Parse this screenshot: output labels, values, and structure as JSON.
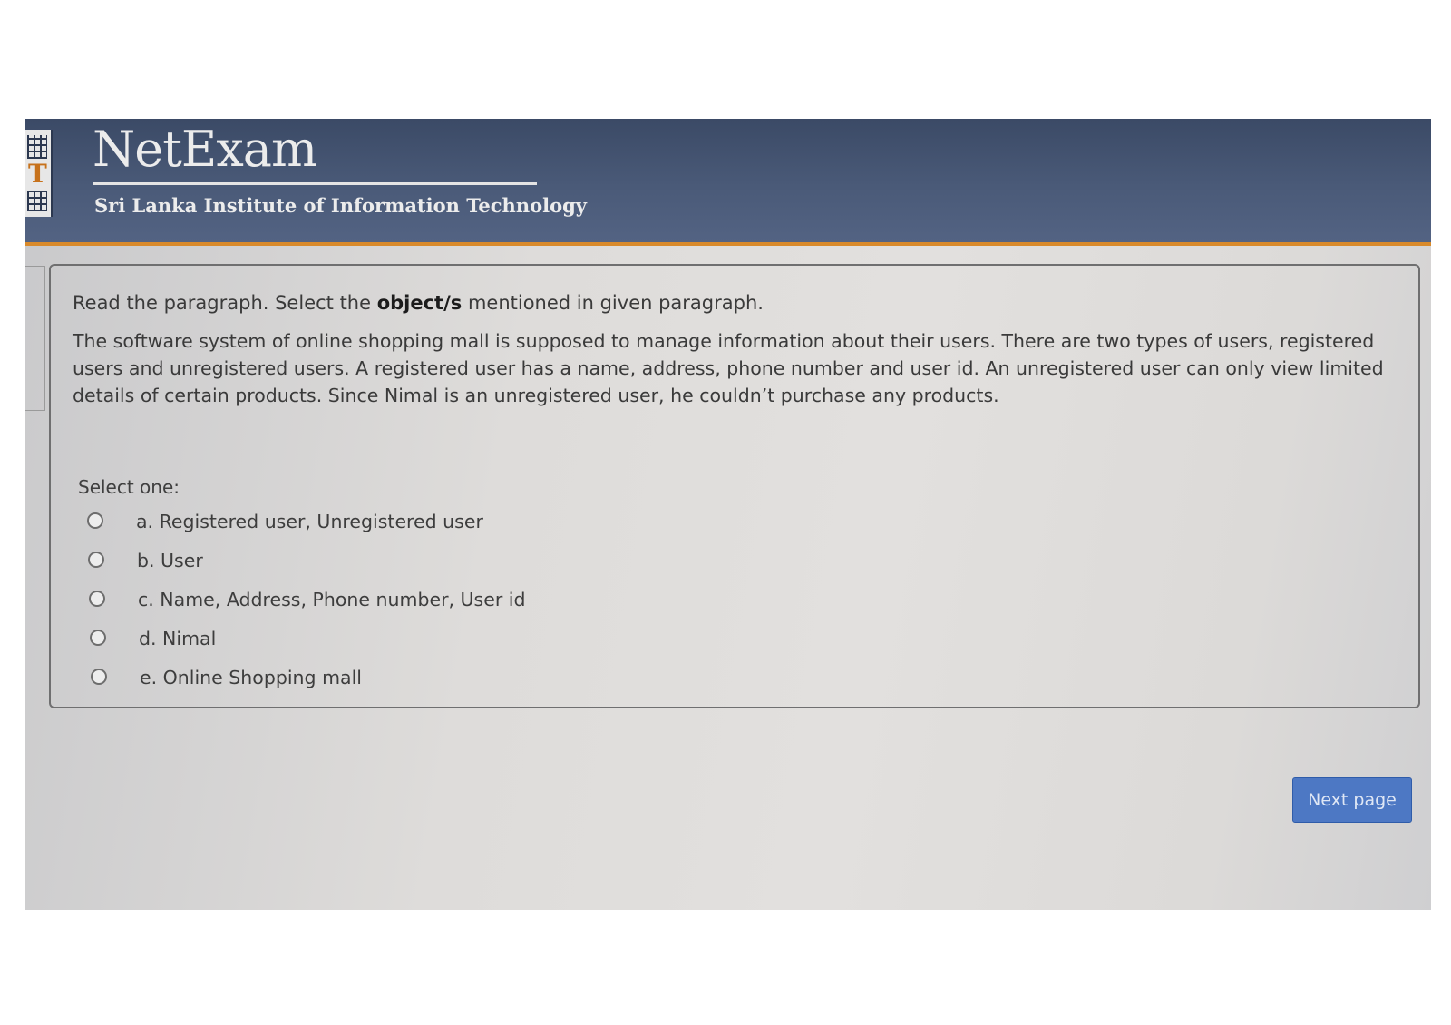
{
  "header": {
    "title": "NetExam",
    "subtitle": "Sri Lanka Institute of Information Technology",
    "logo_letter": "T"
  },
  "question": {
    "instruction_prefix": "Read the paragraph. Select the ",
    "instruction_keyword": "object/s",
    "instruction_suffix": " mentioned in given paragraph.",
    "paragraph": "The software system of online shopping mall is supposed to manage information about their users. There are two types of users,  registered users and unregistered users. A registered user has a name, address, phone number and user id. An unregistered user can only view limited details of certain products. Since Nimal is an unregistered user, he couldn’t purchase any products.",
    "select_prompt": "Select one:",
    "options": [
      {
        "label": "a. Registered user, Unregistered user",
        "selected": false
      },
      {
        "label": "b. User",
        "selected": false
      },
      {
        "label": "c. Name, Address, Phone number, User id",
        "selected": false
      },
      {
        "label": "d. Nimal",
        "selected": false
      },
      {
        "label": "e. Online Shopping mall",
        "selected": false
      }
    ]
  },
  "navigation": {
    "next_label": "Next page"
  },
  "colors": {
    "header_bg": "#3b4a66",
    "header_accent": "#d98a2b",
    "button_bg": "#4d78c4"
  }
}
